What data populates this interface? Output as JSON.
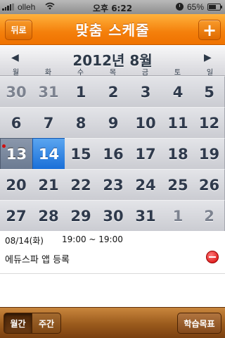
{
  "status_bar": {
    "carrier": "olleh",
    "time": "오후 6:22",
    "battery": "65%",
    "battery_level": 0.65
  },
  "nav": {
    "back_label": "뒤로",
    "title": "맞춤 스케줄",
    "add_label": "+"
  },
  "calendar": {
    "month_label": "2012년 8월",
    "prev_arrow": "◀",
    "next_arrow": "▶",
    "weekdays": [
      "월",
      "화",
      "수",
      "목",
      "금",
      "토",
      "일"
    ],
    "weeks": [
      [
        "30",
        "31",
        "1",
        "2",
        "3",
        "4",
        "5"
      ],
      [
        "6",
        "7",
        "8",
        "9",
        "10",
        "11",
        "12"
      ],
      [
        "13",
        "14",
        "15",
        "16",
        "17",
        "18",
        "19"
      ],
      [
        "20",
        "21",
        "22",
        "23",
        "24",
        "25",
        "26"
      ],
      [
        "27",
        "28",
        "29",
        "30",
        "31",
        "1",
        "2"
      ]
    ],
    "other_month_cells": [
      [
        0,
        0
      ],
      [
        0,
        1
      ],
      [
        4,
        5
      ],
      [
        4,
        6
      ]
    ],
    "today_cell": [
      2,
      0
    ],
    "selected_cell": [
      2,
      1
    ],
    "event_dot_cell": [
      2,
      0
    ]
  },
  "event": {
    "date": "08/14(화)",
    "time": "19:00 ~ 19:00",
    "title": "에듀스파 앱 등록"
  },
  "toolbar": {
    "monthly_label": "월간",
    "weekly_label": "주간",
    "goal_label": "학습목표"
  },
  "colors": {
    "nav_orange": "#f47f0b",
    "selected_blue": "#1a6fd8",
    "toolbar_brown": "#9a5a1c",
    "delete_red": "#d40000"
  }
}
